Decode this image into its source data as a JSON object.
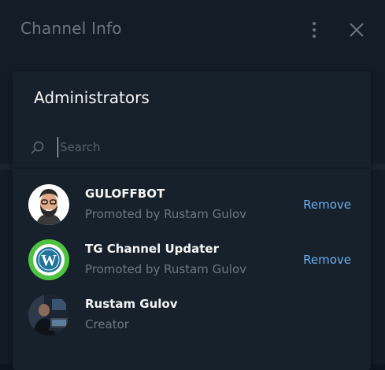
{
  "background": {
    "title": "Channel Info"
  },
  "modal": {
    "title": "Administrators",
    "search_placeholder": "Search"
  },
  "admins": [
    {
      "name": "GULOFFBOT",
      "subtitle": "Promoted by Rustam Gulov",
      "action": "Remove",
      "avatar": "bearded-man-cartoon"
    },
    {
      "name": "TG Channel Updater",
      "subtitle": "Promoted by Rustam Gulov",
      "action": "Remove",
      "avatar": "wordpress-logo"
    },
    {
      "name": "Rustam Gulov",
      "subtitle": "Creator",
      "action": "",
      "avatar": "photo-person-at-computer"
    }
  ],
  "colors": {
    "accent": "#6ab3f3",
    "modal_bg": "#17212b",
    "muted_text": "#6d7883"
  }
}
